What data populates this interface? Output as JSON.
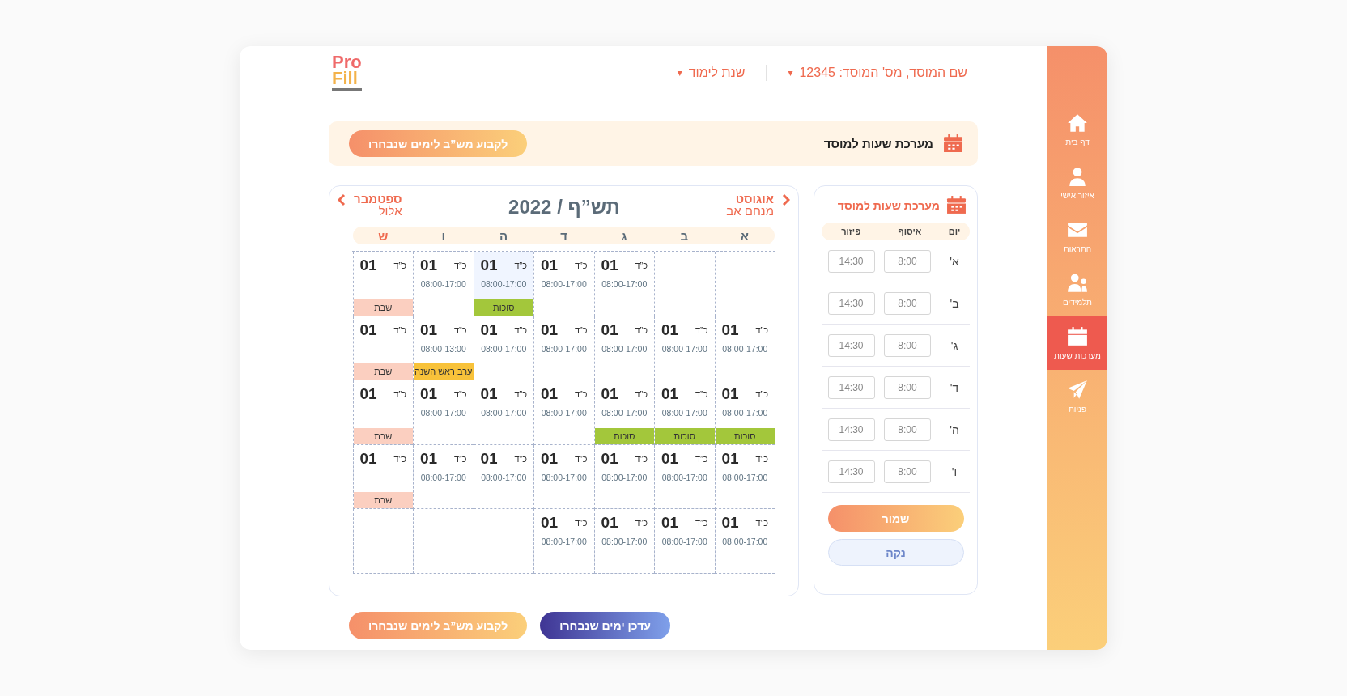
{
  "logo": {
    "line_1": "Pro",
    "line_2": "Fill"
  },
  "header": {
    "institution": "שם המוסד, מס' המוסד: 12345",
    "institution_caret": "▾",
    "year_label": "שנת לימוד",
    "year_caret": "▾"
  },
  "sidebar": {
    "items": [
      {
        "label": "דף בית",
        "selected": false
      },
      {
        "label": "איזור אישי",
        "selected": false
      },
      {
        "label": "התראות",
        "selected": false
      },
      {
        "label": "תלמידים",
        "selected": false
      },
      {
        "label": "מערכות שעות",
        "selected": true
      },
      {
        "label": "פניות",
        "selected": false
      }
    ]
  },
  "banner": {
    "title": "מערכת שעות למוסד",
    "button": "לקבוע מש”ב לימים שנבחרו"
  },
  "calendar": {
    "title": "תש”ף / 2022",
    "prev": {
      "month": "אוגוסט",
      "hebrew_month": "מנחם אב"
    },
    "next": {
      "month": "ספטמבר",
      "hebrew_month": "אלול"
    },
    "weekdays": [
      {
        "label": "א",
        "weekend": false
      },
      {
        "label": "ב",
        "weekend": false
      },
      {
        "label": "ג",
        "weekend": false
      },
      {
        "label": "ד",
        "weekend": false
      },
      {
        "label": "ה",
        "weekend": false
      },
      {
        "label": "ו",
        "weekend": false
      },
      {
        "label": "ש",
        "weekend": true
      }
    ],
    "weeks": [
      [
        {
          "kind": "blank"
        },
        {
          "kind": "blank"
        },
        {
          "kind": "day",
          "hebrew_date": "כ”ד",
          "day": "01",
          "hours": "08:00-17:00",
          "selected": false
        },
        {
          "kind": "day",
          "hebrew_date": "כ”ד",
          "day": "01",
          "hours": "08:00-17:00",
          "selected": false
        },
        {
          "kind": "day",
          "hebrew_date": "כ”ד",
          "day": "01",
          "hours": "08:00-17:00",
          "selected": true,
          "event": {
            "label": "סוכות",
            "color": "#a3c73b"
          }
        },
        {
          "kind": "day",
          "hebrew_date": "כ”ד",
          "day": "01",
          "hours": "08:00-17:00",
          "selected": false
        },
        {
          "kind": "day",
          "hebrew_date": "כ”ד",
          "day": "01",
          "selected": false,
          "event": {
            "label": "שבת",
            "color": "#fbcfc0"
          }
        }
      ],
      [
        {
          "kind": "day",
          "hebrew_date": "כ”ד",
          "day": "01",
          "hours": "08:00-17:00",
          "selected": false
        },
        {
          "kind": "day",
          "hebrew_date": "כ”ד",
          "day": "01",
          "hours": "08:00-17:00",
          "selected": false
        },
        {
          "kind": "day",
          "hebrew_date": "כ”ד",
          "day": "01",
          "hours": "08:00-17:00",
          "selected": false
        },
        {
          "kind": "day",
          "hebrew_date": "כ”ד",
          "day": "01",
          "hours": "08:00-17:00",
          "selected": false
        },
        {
          "kind": "day",
          "hebrew_date": "כ”ד",
          "day": "01",
          "hours": "08:00-17:00",
          "selected": false
        },
        {
          "kind": "day",
          "hebrew_date": "כ”ד",
          "day": "01",
          "hours": "08:00-13:00",
          "selected": false,
          "event": {
            "label": "ערב ראש השנה",
            "color": "#f8c23a"
          }
        },
        {
          "kind": "day",
          "hebrew_date": "כ”ד",
          "day": "01",
          "selected": false,
          "event": {
            "label": "שבת",
            "color": "#fbcfc0"
          }
        }
      ],
      [
        {
          "kind": "day",
          "hebrew_date": "כ”ד",
          "day": "01",
          "hours": "08:00-17:00",
          "selected": false,
          "event": {
            "label": "סוכות",
            "color": "#a3c73b"
          }
        },
        {
          "kind": "day",
          "hebrew_date": "כ”ד",
          "day": "01",
          "hours": "08:00-17:00",
          "selected": false,
          "event": {
            "label": "סוכות",
            "color": "#a3c73b"
          }
        },
        {
          "kind": "day",
          "hebrew_date": "כ”ד",
          "day": "01",
          "hours": "08:00-17:00",
          "selected": false,
          "event": {
            "label": "סוכות",
            "color": "#a3c73b"
          }
        },
        {
          "kind": "day",
          "hebrew_date": "כ”ד",
          "day": "01",
          "hours": "08:00-17:00",
          "selected": false
        },
        {
          "kind": "day",
          "hebrew_date": "כ”ד",
          "day": "01",
          "hours": "08:00-17:00",
          "selected": false
        },
        {
          "kind": "day",
          "hebrew_date": "כ”ד",
          "day": "01",
          "hours": "08:00-17:00",
          "selected": false
        },
        {
          "kind": "day",
          "hebrew_date": "כ”ד",
          "day": "01",
          "selected": false,
          "event": {
            "label": "שבת",
            "color": "#fbcfc0"
          }
        }
      ],
      [
        {
          "kind": "day",
          "hebrew_date": "כ”ד",
          "day": "01",
          "hours": "08:00-17:00",
          "selected": false
        },
        {
          "kind": "day",
          "hebrew_date": "כ”ד",
          "day": "01",
          "hours": "08:00-17:00",
          "selected": false
        },
        {
          "kind": "day",
          "hebrew_date": "כ”ד",
          "day": "01",
          "hours": "08:00-17:00",
          "selected": false
        },
        {
          "kind": "day",
          "hebrew_date": "כ”ד",
          "day": "01",
          "hours": "08:00-17:00",
          "selected": false
        },
        {
          "kind": "day",
          "hebrew_date": "כ”ד",
          "day": "01",
          "hours": "08:00-17:00",
          "selected": false
        },
        {
          "kind": "day",
          "hebrew_date": "כ”ד",
          "day": "01",
          "hours": "08:00-17:00",
          "selected": false
        },
        {
          "kind": "day",
          "hebrew_date": "כ”ד",
          "day": "01",
          "selected": false,
          "event": {
            "label": "שבת",
            "color": "#fbcfc0"
          }
        }
      ],
      [
        {
          "kind": "day",
          "hebrew_date": "כ”ד",
          "day": "01",
          "hours": "08:00-17:00",
          "selected": false
        },
        {
          "kind": "day",
          "hebrew_date": "כ”ד",
          "day": "01",
          "hours": "08:00-17:00",
          "selected": false
        },
        {
          "kind": "day",
          "hebrew_date": "כ”ד",
          "day": "01",
          "hours": "08:00-17:00",
          "selected": false
        },
        {
          "kind": "day",
          "hebrew_date": "כ”ד",
          "day": "01",
          "hours": "08:00-17:00",
          "selected": false
        },
        {
          "kind": "blank"
        },
        {
          "kind": "blank"
        },
        {
          "kind": "blank"
        }
      ]
    ]
  },
  "hours_panel": {
    "title": "מערכת שעות למוסד",
    "columns": [
      "יום",
      "איסוף",
      "פיזור"
    ],
    "rows": [
      {
        "day": "א'",
        "pickup": "8:00",
        "dropoff": "14:30"
      },
      {
        "day": "ב'",
        "pickup": "8:00",
        "dropoff": "14:30"
      },
      {
        "day": "ג'",
        "pickup": "8:00",
        "dropoff": "14:30"
      },
      {
        "day": "ד'",
        "pickup": "8:00",
        "dropoff": "14:30"
      },
      {
        "day": "ה'",
        "pickup": "8:00",
        "dropoff": "14:30"
      },
      {
        "day": "ו'",
        "pickup": "8:00",
        "dropoff": "14:30"
      }
    ],
    "save_button": "שמור",
    "clear_button": "נקה"
  },
  "footer_buttons": [
    {
      "label": "עדכן ימים שנבחרו",
      "kind": "secondary"
    },
    {
      "label": "לקבוע מש”ב לימים שנבחרו",
      "kind": "primary"
    }
  ]
}
